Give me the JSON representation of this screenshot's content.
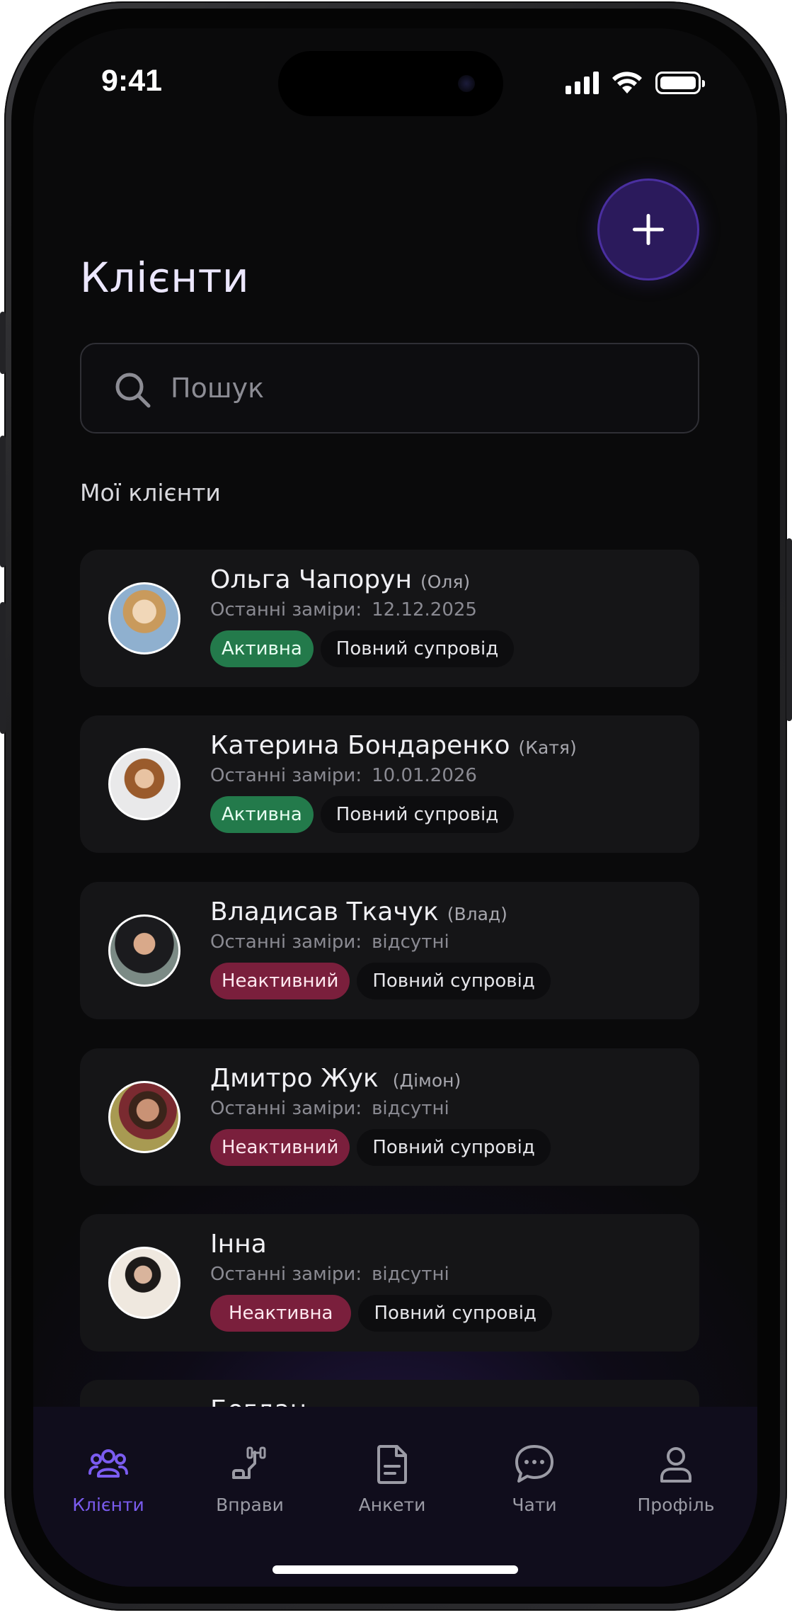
{
  "status_bar": {
    "time": "9:41"
  },
  "header": {
    "title": "Клієнти",
    "add_icon": "plus-icon"
  },
  "search": {
    "placeholder": "Пошук",
    "icon": "search-icon"
  },
  "section": {
    "label": "Мої клієнти"
  },
  "clients": [
    {
      "name": "Ольга Чапорун",
      "nickname": "(Оля)",
      "measurements_label": "Останні заміри:",
      "measurements_value": "12.12.2025",
      "status": "Активна",
      "plan": "Повний супровід"
    },
    {
      "name": "Катерина Бондаренко",
      "nickname": "(Катя)",
      "measurements_label": "Останні заміри:",
      "measurements_value": "10.01.2026",
      "status": "Активна",
      "plan": "Повний супровід"
    },
    {
      "name": "Владисав Ткачук",
      "nickname": "(Влад)",
      "measurements_label": "Останні заміри:",
      "measurements_value": "відсутні",
      "status": "Неактивний",
      "plan": "Повний супровід"
    },
    {
      "name": "Дмитро Жук",
      "nickname": "(Дімон)",
      "measurements_label": "Останні заміри:",
      "measurements_value": "відсутні",
      "status": "Неактивний",
      "plan": "Повний супровід"
    },
    {
      "name": "Інна",
      "nickname": "",
      "measurements_label": "Останні заміри:",
      "measurements_value": "відсутні",
      "status": "Неактивна",
      "plan": "Повний супровід"
    },
    {
      "name": "Богдан"
    }
  ],
  "tabbar": {
    "items": [
      {
        "label": "Клієнти",
        "icon": "clients-icon",
        "selected": true
      },
      {
        "label": "Вправи",
        "icon": "exercises-icon",
        "selected": false
      },
      {
        "label": "Анкети",
        "icon": "questionnaire-icon",
        "selected": false
      },
      {
        "label": "Чати",
        "icon": "chat-icon",
        "selected": false
      },
      {
        "label": "Профіль",
        "icon": "profile-icon",
        "selected": false
      }
    ]
  },
  "colors": {
    "accent": "#7b5cf0",
    "active_badge": "#237a4b",
    "inactive_badge": "#7a1f3c",
    "background": "#0a0a0b",
    "card": "#151517"
  }
}
